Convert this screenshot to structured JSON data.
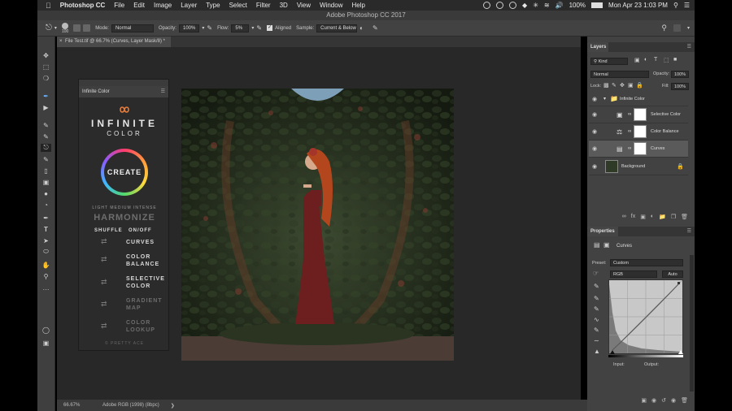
{
  "menubar": {
    "app": "Photoshop CC",
    "items": [
      "File",
      "Edit",
      "Image",
      "Layer",
      "Type",
      "Select",
      "Filter",
      "3D",
      "View",
      "Window",
      "Help"
    ],
    "battery": "100%",
    "datetime": "Mon Apr 23  1:03 PM"
  },
  "window": {
    "title": "Adobe Photoshop CC 2017"
  },
  "options": {
    "brush_size": "100",
    "mode_label": "Mode:",
    "mode_value": "Normal",
    "opacity_label": "Opacity:",
    "opacity_value": "100%",
    "flow_label": "Flow:",
    "flow_value": "5%",
    "aligned_label": "Aligned",
    "sample_label": "Sample:",
    "sample_value": "Current & Below"
  },
  "document": {
    "tab_label": "File Test.tif @ 66.7% (Curves, Layer Mask/8) *",
    "zoom": "66.67%",
    "color_profile": "Adobe RGB (1998) (8bpc)"
  },
  "infinite_color": {
    "panel_title": "Infinite Color",
    "logo_word1": "INFINITE",
    "logo_word2": "COLOR",
    "create_label": "CREATE",
    "intensity_label": "LIGHT MEDIUM INTENSE",
    "harmonize_label": "HARMONIZE",
    "shuffle_header": "SHUFFLE",
    "onoff_header": "ON/OFF",
    "options": [
      {
        "label": "CURVES",
        "enabled": true
      },
      {
        "label": "COLOR BALANCE",
        "enabled": true
      },
      {
        "label": "SELECTIVE COLOR",
        "enabled": true
      },
      {
        "label": "GRADIENT MAP",
        "enabled": false
      },
      {
        "label": "COLOR LOOKUP",
        "enabled": false
      }
    ],
    "footer": "© PRETTY ACE"
  },
  "layers": {
    "panel_title": "Layers",
    "filter_value": "Kind",
    "blend_value": "Normal",
    "opacity_label": "Opacity:",
    "opacity_value": "100%",
    "lock_label": "Lock:",
    "fill_label": "Fill:",
    "fill_value": "100%",
    "items": [
      {
        "name": "Infinite Color",
        "kind": "group"
      },
      {
        "name": "Selective Color",
        "kind": "adjustment"
      },
      {
        "name": "Color Balance",
        "kind": "adjustment"
      },
      {
        "name": "Curves",
        "kind": "adjustment",
        "selected": true
      },
      {
        "name": "Background",
        "kind": "image"
      }
    ]
  },
  "properties": {
    "panel_title": "Properties",
    "layer_name": "Curves",
    "preset_label": "Preset:",
    "preset_value": "Custom",
    "channel_value": "RGB",
    "auto_label": "Auto",
    "input_label": "Input:",
    "output_label": "Output:"
  },
  "colors": {
    "accent": "#cd8a2a",
    "ring_a": "#ff3b6b",
    "ring_b": "#3fb6ff"
  }
}
